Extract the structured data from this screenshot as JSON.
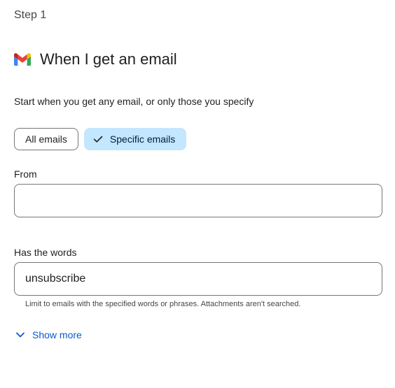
{
  "step": {
    "label": "Step 1"
  },
  "trigger": {
    "icon": "gmail-icon",
    "title": "When I get an email",
    "description": "Start when you get any email, or only those you specify"
  },
  "filter_chips": {
    "all_label": "All emails",
    "specific_label": "Specific emails",
    "selected": "Specific emails",
    "selected_icon": "checkmark-icon"
  },
  "fields": {
    "from": {
      "label": "From",
      "value": ""
    },
    "has_words": {
      "label": "Has the words",
      "value": "unsubscribe",
      "helper": "Limit to emails with the specified words or phrases. Attachments aren't searched."
    }
  },
  "show_more": {
    "label": "Show more",
    "icon": "chevron-down-icon"
  },
  "colors": {
    "accent": "#0b57d0",
    "chip_selected_bg": "#c2e7ff",
    "gmail_red": "#ea4335",
    "gmail_blue": "#4285f4",
    "gmail_green": "#34a853",
    "gmail_yellow": "#fbbc04",
    "gmail_dark_red": "#c5221f"
  }
}
